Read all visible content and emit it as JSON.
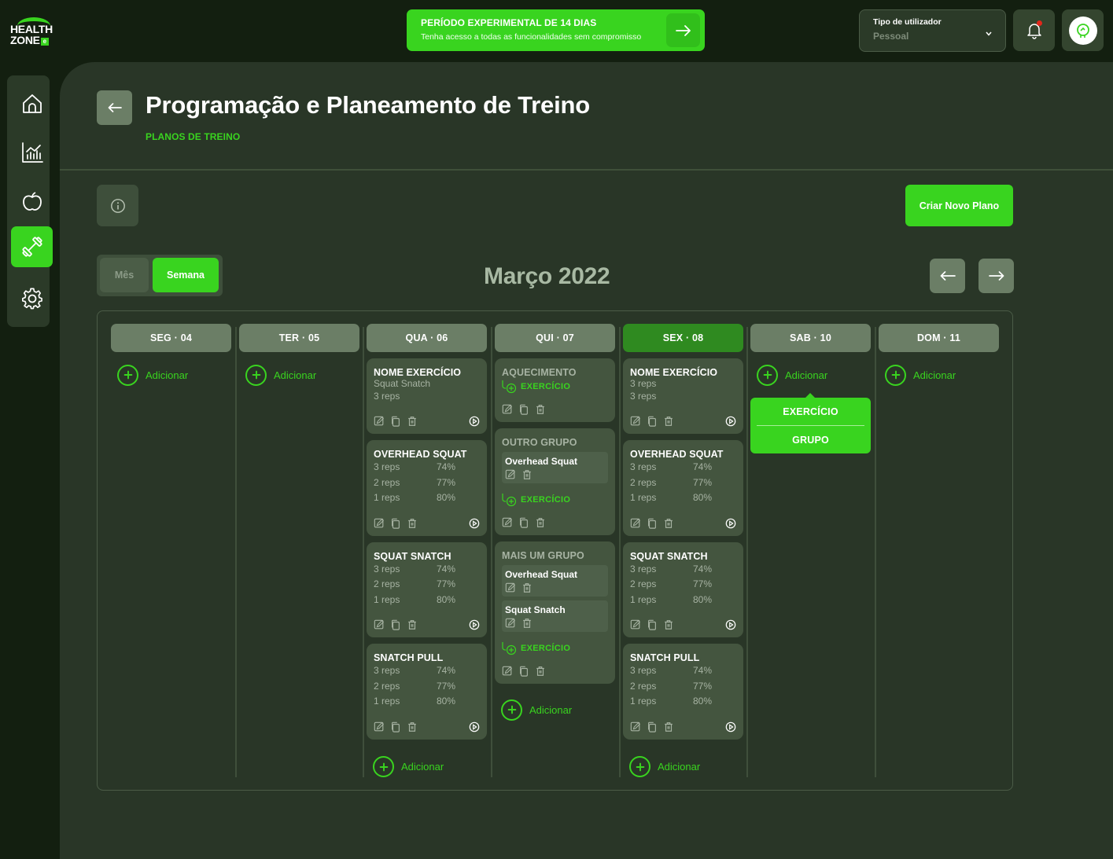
{
  "brand": {
    "line1": "HEALTH",
    "line2": "ZONE",
    "badge": "e"
  },
  "trial_banner": {
    "title": "PERÍODO EXPERIMENTAL DE 14 DIAS",
    "subtitle": "Tenha acesso a todas as funcionalidades sem compromisso",
    "icon": "arrow-right-icon"
  },
  "user_type": {
    "label": "Tipo de utilizador",
    "value": "Pessoal"
  },
  "notifications": {
    "icon": "bell-icon",
    "has_unread": true
  },
  "colors": {
    "accent": "#39d41f",
    "today": "#2f8a20",
    "background": "#131f10",
    "panel": "#293627",
    "card": "#44553f",
    "unread_dot": "#e2261a"
  },
  "sidebar": {
    "items": [
      {
        "name": "home",
        "icon": "home-icon",
        "active": false
      },
      {
        "name": "stats",
        "icon": "chart-icon",
        "active": false
      },
      {
        "name": "nutrition",
        "icon": "apple-icon",
        "active": false
      },
      {
        "name": "training",
        "icon": "dumbbell-icon",
        "active": true
      },
      {
        "name": "settings",
        "icon": "gear-icon",
        "active": false
      }
    ]
  },
  "header": {
    "title": "Programação e Planeamento de Treino",
    "breadcrumb": "PLANOS DE TREINO"
  },
  "toolbar": {
    "create_label": "Criar Novo Plano",
    "view_month": "Mês",
    "view_week": "Semana",
    "active_view": "Semana"
  },
  "calendar": {
    "month_title": "Março 2022",
    "add_label": "Adicionar",
    "add_exercise_label": "EXERCÍCIO",
    "popover": {
      "exercise": "EXERCÍCIO",
      "group": "GRUPO"
    },
    "days": [
      {
        "label": "SEG · 04"
      },
      {
        "label": "TER · 05"
      },
      {
        "label": "QUA · 06"
      },
      {
        "label": "QUI · 07"
      },
      {
        "label": "SEX · 08",
        "today": true
      },
      {
        "label": "SAB · 10"
      },
      {
        "label": "DOM · 11"
      }
    ],
    "wed": {
      "first": {
        "title": "NOME EXERCÍCIO",
        "lines": [
          "Squat Snatch",
          "3 reps"
        ]
      },
      "exercises": [
        {
          "title": "OVERHEAD SQUAT",
          "sets": [
            [
              "3 reps",
              "74%"
            ],
            [
              "2 reps",
              "77%"
            ],
            [
              "1 reps",
              "80%"
            ]
          ]
        },
        {
          "title": "SQUAT SNATCH",
          "sets": [
            [
              "3 reps",
              "74%"
            ],
            [
              "2 reps",
              "77%"
            ],
            [
              "1 reps",
              "80%"
            ]
          ]
        },
        {
          "title": "SNATCH PULL",
          "sets": [
            [
              "3 reps",
              "74%"
            ],
            [
              "2 reps",
              "77%"
            ],
            [
              "1 reps",
              "80%"
            ]
          ]
        }
      ]
    },
    "thu": {
      "groups": [
        {
          "title": "AQUECIMENTO",
          "items": []
        },
        {
          "title": "OUTRO GRUPO",
          "items": [
            "Overhead Squat"
          ]
        },
        {
          "title": "MAIS UM GRUPO",
          "items": [
            "Overhead Squat",
            "Squat Snatch"
          ]
        }
      ]
    },
    "fri": {
      "first": {
        "title": "NOME EXERCÍCIO",
        "lines": [
          "3 reps",
          "3 reps"
        ]
      },
      "exercises": [
        {
          "title": "OVERHEAD SQUAT",
          "sets": [
            [
              "3 reps",
              "74%"
            ],
            [
              "2 reps",
              "77%"
            ],
            [
              "1 reps",
              "80%"
            ]
          ]
        },
        {
          "title": "SQUAT SNATCH",
          "sets": [
            [
              "3 reps",
              "74%"
            ],
            [
              "2 reps",
              "77%"
            ],
            [
              "1 reps",
              "80%"
            ]
          ]
        },
        {
          "title": "SNATCH PULL",
          "sets": [
            [
              "3 reps",
              "74%"
            ],
            [
              "2 reps",
              "77%"
            ],
            [
              "1 reps",
              "80%"
            ]
          ]
        }
      ]
    }
  }
}
